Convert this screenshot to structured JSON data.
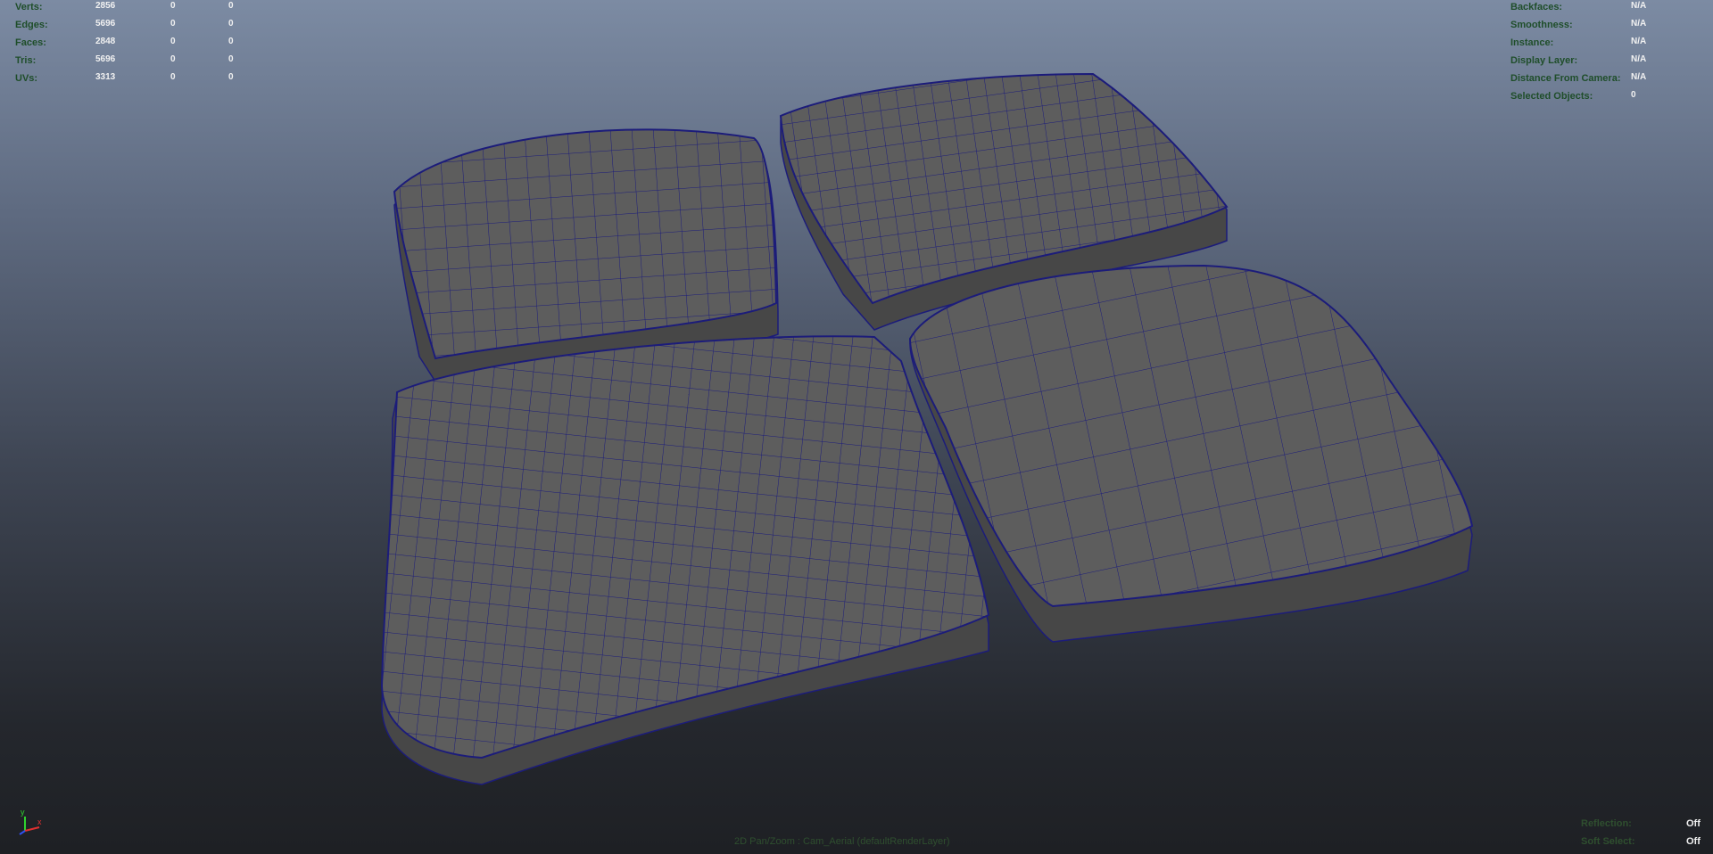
{
  "stats": {
    "rows": [
      {
        "label": "Verts:",
        "total": "2856",
        "sel": "0",
        "ui": "0"
      },
      {
        "label": "Edges:",
        "total": "5696",
        "sel": "0",
        "ui": "0"
      },
      {
        "label": "Faces:",
        "total": "2848",
        "sel": "0",
        "ui": "0"
      },
      {
        "label": "Tris:",
        "total": "5696",
        "sel": "0",
        "ui": "0"
      },
      {
        "label": "UVs:",
        "total": "3313",
        "sel": "0",
        "ui": "0"
      }
    ]
  },
  "object_info": {
    "rows": [
      {
        "label": "Backfaces:",
        "value": "N/A"
      },
      {
        "label": "Smoothness:",
        "value": "N/A"
      },
      {
        "label": "Instance:",
        "value": "N/A"
      },
      {
        "label": "Display Layer:",
        "value": "N/A"
      },
      {
        "label": "Distance From Camera:",
        "value": "N/A"
      },
      {
        "label": "Selected Objects:",
        "value": "0"
      }
    ]
  },
  "bottom_bar": {
    "camera_label": "2D Pan/Zoom : Cam_Aerial (defaultRenderLayer)",
    "reflection_label": "Reflection:",
    "reflection_value": "Off",
    "soft_select_label": "Soft Select:",
    "soft_select_value": "Off"
  },
  "axis": {
    "y_label": "y",
    "x_label": "x"
  },
  "colors": {
    "wire": "#1c1c7a",
    "surface": "#5e5e5e",
    "side": "#4a4a4a",
    "hud_label": "#1f4e2a",
    "hud_value": "#f1f1f1"
  },
  "scene": {
    "object_type": "bread slices polygon mesh"
  }
}
